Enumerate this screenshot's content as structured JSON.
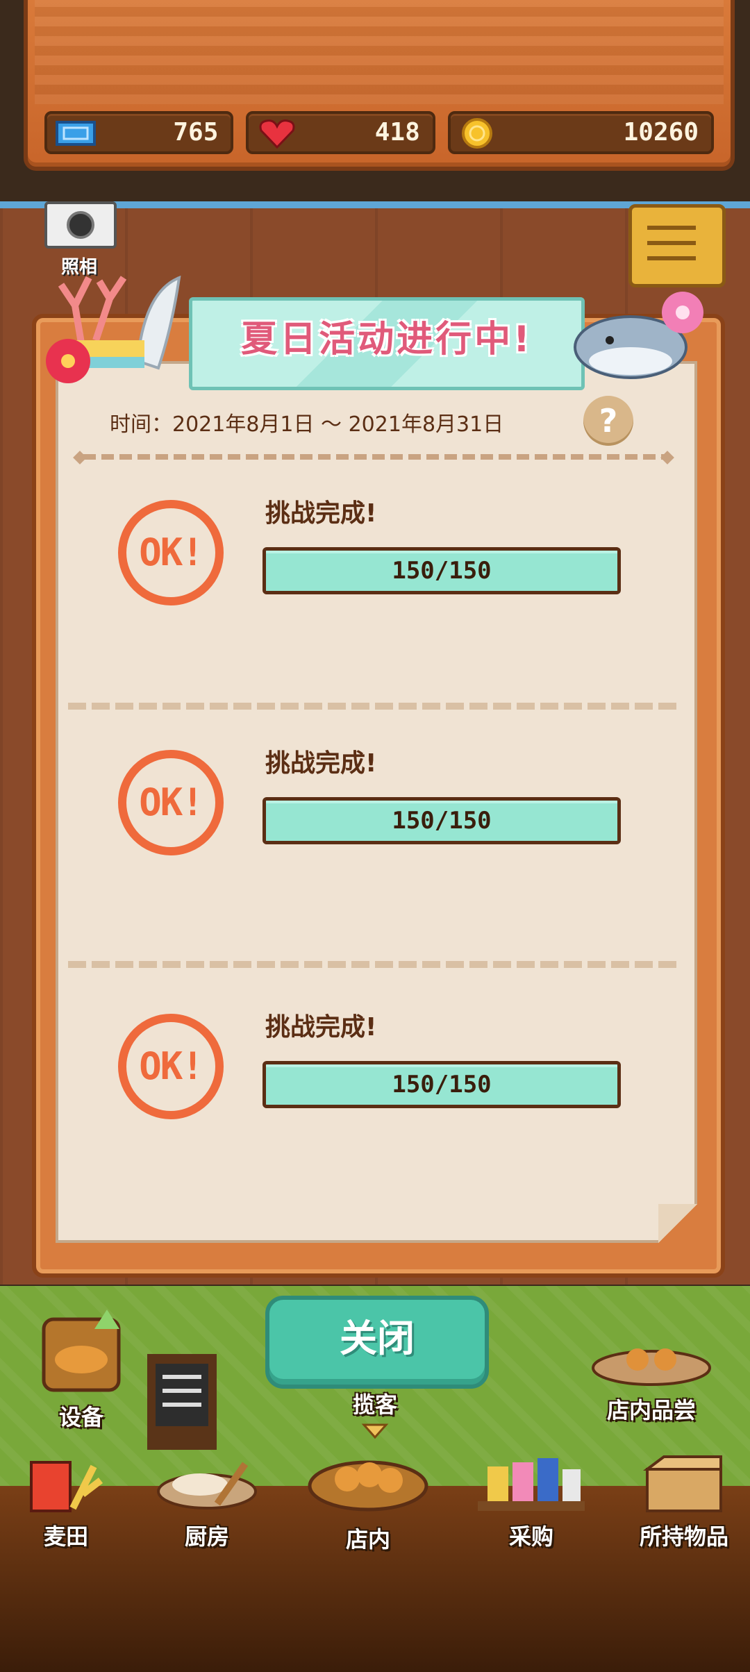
{
  "resources": {
    "tickets": "765",
    "hearts": "418",
    "coins": "10260"
  },
  "camera_label": "照相",
  "event": {
    "title": "夏日活动进行中!",
    "date_range": "时间：2021年8月1日 ～ 2021年8月31日",
    "help": "?",
    "tasks": [
      {
        "stamp": "OK!",
        "title": "挑战完成!",
        "progress_text": "150/150",
        "progress": 1.0
      },
      {
        "stamp": "OK!",
        "title": "挑战完成!",
        "progress_text": "150/150",
        "progress": 1.0
      },
      {
        "stamp": "OK!",
        "title": "挑战完成!",
        "progress_text": "150/150",
        "progress": 1.0
      }
    ]
  },
  "close_label": "关闭",
  "shop_actions": {
    "equipment": "设备",
    "attract": "揽客",
    "tasting": "店内品尝"
  },
  "bottom_nav": [
    "麦田",
    "厨房",
    "店内",
    "采购",
    "所持物品"
  ],
  "colors": {
    "accent_teal": "#4bc5a8",
    "stamp_orange": "#ef6a3c",
    "progress_fill": "#96e6d2",
    "title_pink": "#e05a7a"
  }
}
